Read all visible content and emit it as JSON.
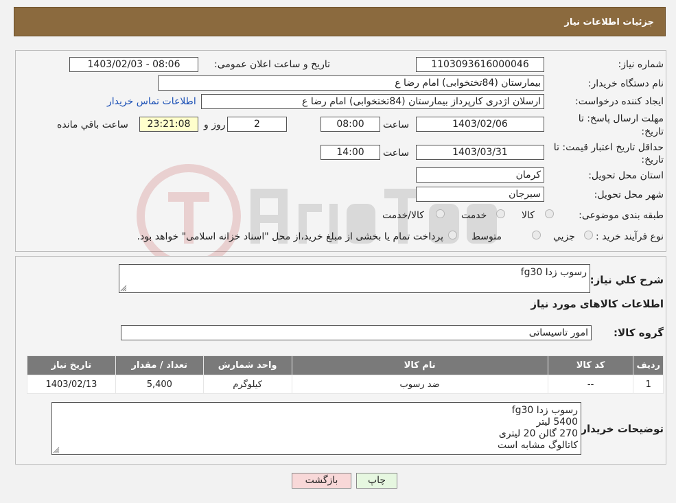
{
  "header": {
    "title": "جزئیات اطلاعات نیاز"
  },
  "form": {
    "need_number_label": "شماره نیاز:",
    "need_number": "1103093616000046",
    "announce_label": "تاریخ و ساعت اعلان عمومی:",
    "announce_value": "1403/02/03 - 08:06",
    "buyer_org_label": "نام دستگاه خریدار:",
    "buyer_org": "بیمارستان (84تختخوابی) امام رضا  ع",
    "creator_label": "ایجاد کننده درخواست:",
    "creator": "ارسلان اژدری کارپرداز بیمارستان (84تختخوابی) امام رضا  ع",
    "contact_link": "اطلاعات تماس خریدار",
    "deadline_label_1": "مهلت ارسال پاسخ: تا",
    "deadline_label_2": "تاریخ:",
    "deadline_date": "1403/02/06",
    "time_label": "ساعت",
    "deadline_time": "08:00",
    "days_value": "2",
    "days_label": "روز و",
    "remaining_time": "23:21:08",
    "remaining_label": "ساعت باقي مانده",
    "validity_label_1": "حداقل تاریخ اعتبار قیمت: تا",
    "validity_label_2": "تاریخ:",
    "validity_date": "1403/03/31",
    "validity_time": "14:00",
    "province_label": "استان محل تحویل:",
    "province": "کرمان",
    "city_label": "شهر محل تحویل:",
    "city": "سیرجان",
    "category_label": "طبقه بندی موضوعی:",
    "category_options": [
      "کالا",
      "خدمت",
      "کالا/خدمت"
    ],
    "process_label": "نوع فرآیند خرید :",
    "process_options": [
      "جزيي",
      "متوسط"
    ],
    "process_note": "پرداخت تمام یا بخشی از مبلغ خرید،از محل \"اسناد خزانه اسلامی\" خواهد بود."
  },
  "details": {
    "summary_label": "شرح كلي نياز:",
    "summary": "رسوب زدا fg30",
    "goods_info_title": "اطلاعات کالاهای مورد نیاز",
    "group_label": "گروه کالا:",
    "group": "امور تاسیساتی",
    "table": {
      "headers": [
        "رديف",
        "کد کالا",
        "نام کالا",
        "واحد شمارش",
        "تعداد / مقدار",
        "تاریخ نیاز"
      ],
      "rows": [
        [
          "1",
          "--",
          "ضد رسوب",
          "کیلوگرم",
          "5,400",
          "1403/02/13"
        ]
      ]
    },
    "buyer_notes_label": "توضیحات خریدار:",
    "buyer_notes": [
      "رسوب زدا fg30",
      "5400 لیتر",
      "270 گالن 20 لیتری",
      "کاتالوگ مشابه است"
    ]
  },
  "buttons": {
    "print": "چاپ",
    "back": "بازگشت"
  },
  "colors": {
    "header": "#8b6a3e",
    "table_header": "#7a7a7a",
    "highlight": "#ffffcc",
    "back_button": "#f8d8d8",
    "print_button": "#e6f7e0"
  }
}
